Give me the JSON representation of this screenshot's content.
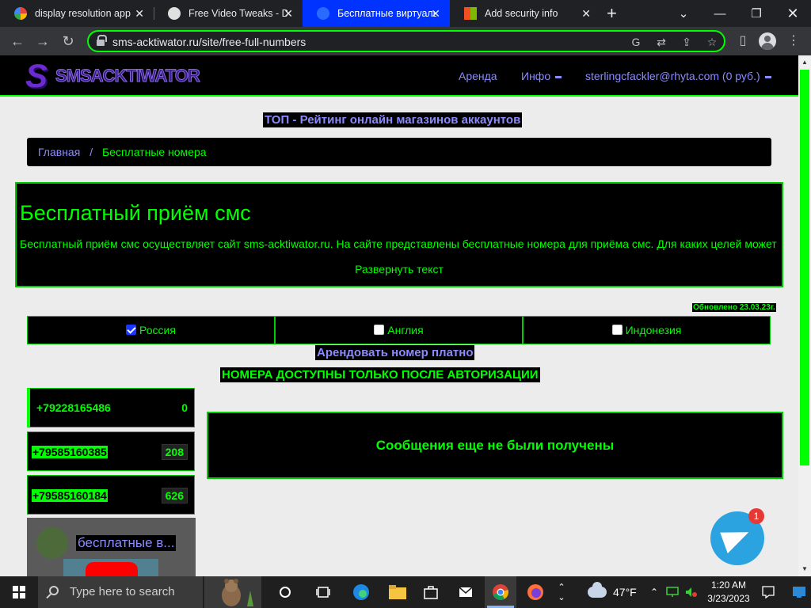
{
  "browser": {
    "tabs": [
      {
        "title": "display resolution app",
        "favicon": "google-icon",
        "active": false
      },
      {
        "title": "Free Video Tweaks - Do",
        "favicon": "generic-site-icon",
        "active": false
      },
      {
        "title": "Бесплатные виртуалы",
        "favicon": "sms-site-icon",
        "active": true
      },
      {
        "title": "Add security info",
        "favicon": "microsoft-icon",
        "active": false
      }
    ],
    "url": "sms-acktiwator.ru/site/free-full-numbers",
    "accent_color": "#00ff00",
    "active_tab_color": "#0033ff"
  },
  "site": {
    "logo_text": "SMSACKTIWATOR",
    "nav": {
      "rent": "Аренда",
      "info": "Инфо",
      "account": "sterlingcfackler@rhyta.com (0 руб.)"
    },
    "top_link": "ТОП - Рейтинг онлайн магазинов аккаунтов",
    "breadcrumb": {
      "home": "Главная",
      "separator": "/",
      "current": "Бесплатные номера"
    },
    "intro": {
      "heading": "Бесплатный приём смс",
      "text": "Бесплатный приём смс осуществляет сайт sms-acktiwator.ru. На сайте представлены бесплатные номера для приёма смс. Для каких целей может",
      "expand_link": "Развернуть текст"
    },
    "updated_badge": "Обновлено 23.03.23г.",
    "countries": [
      {
        "label": "Россия",
        "checked": true
      },
      {
        "label": "Англия",
        "checked": false
      },
      {
        "label": "Индонезия",
        "checked": false
      }
    ],
    "rent_paid_link": "Арендовать номер платно",
    "auth_notice": "НОМЕРА ДОСТУПНЫ ТОЛЬКО ПОСЛЕ АВТОРИЗАЦИИ",
    "numbers": [
      {
        "number": "+79228165486",
        "count": "0"
      },
      {
        "number": "+79585160385",
        "count": "208"
      },
      {
        "number": "+79585160184",
        "count": "626"
      }
    ],
    "messages_empty": "Сообщения еще не были получены",
    "video": {
      "title": "бесплатные в...",
      "channel_icon": "channel-avatar"
    },
    "telegram": {
      "badge": "1"
    }
  },
  "taskbar": {
    "search_placeholder": "Type here to search",
    "weather": "47°F",
    "time": "1:20 AM",
    "date": "3/23/2023"
  }
}
